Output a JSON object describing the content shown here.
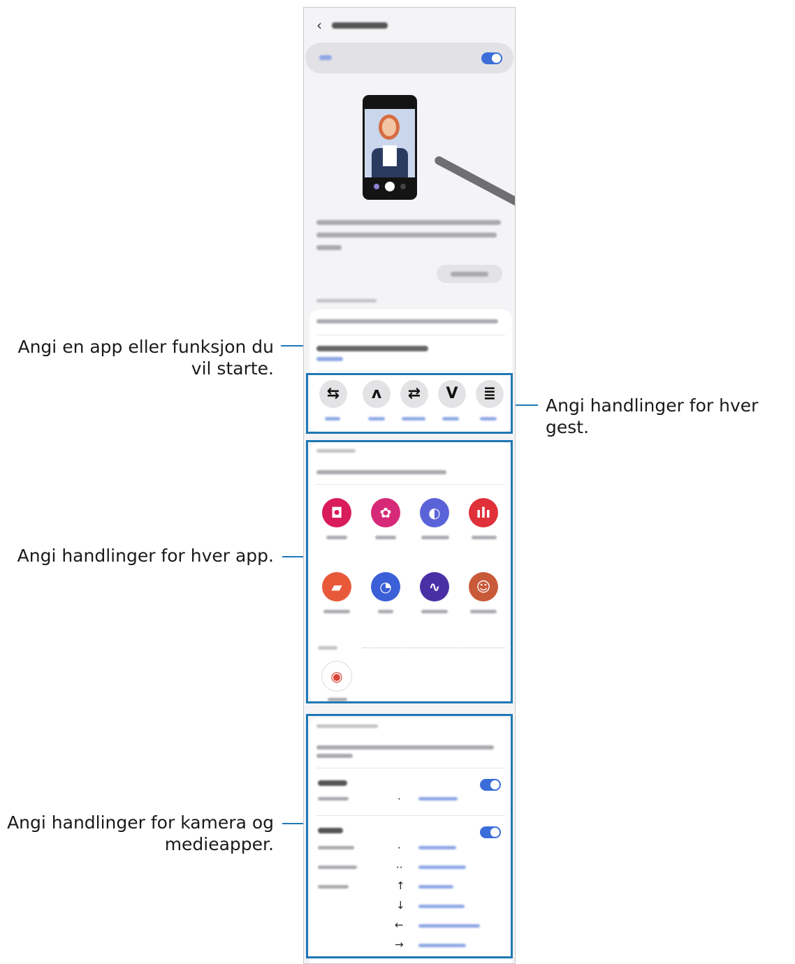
{
  "callouts": {
    "app_function": "Angi en app eller funksjon du vil starte.",
    "each_app": "Angi handlinger for hver app.",
    "camera_media": "Angi handlinger for kamera og medieapper.",
    "each_gesture": "Angi handlinger for hver gest."
  },
  "header": {
    "back_glyph": "‹"
  },
  "gestures": [
    "ᔓ",
    "ᐱ",
    "⥂",
    "ᐯ",
    "≋"
  ],
  "gesture_symbols": [
    "⇆",
    "ᴧ",
    "⇄",
    "V",
    "≣"
  ],
  "camera_symbols": [
    "·"
  ],
  "media_symbols": [
    "·",
    "··",
    "↑",
    "↓",
    "←",
    "→"
  ],
  "colors": {
    "accent_blue": "#1f78b4",
    "toggle_blue": "#3b6ed9",
    "camera_app": "#d81b5b",
    "gallery_app": "#d62a78",
    "internet_app": "#5a63d8",
    "voice_recorder_app": "#e0303a",
    "notes_app": "#e8593a",
    "clock_app": "#3a5fd6",
    "ar_doodle_app": "#4b2fa5"
  },
  "icons": {
    "apps_row1": [
      "camera-icon",
      "gallery-icon",
      "internet-icon",
      "voice-recorder-icon"
    ],
    "apps_row2": [
      "notes-icon",
      "clock-icon",
      "ar-doodle-icon",
      "ar-emoji-icon"
    ],
    "apps_row3": [
      "chrome-icon"
    ]
  }
}
